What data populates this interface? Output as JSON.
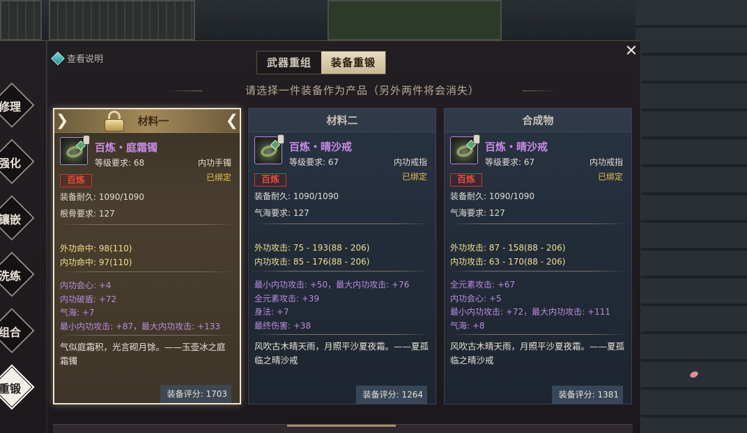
{
  "header": {
    "help_label": "查看说明",
    "tabs": [
      {
        "label": "武器重组",
        "active": false
      },
      {
        "label": "装备重锻",
        "active": true
      }
    ],
    "prompt": "请选择一件装备作为产品（另外两件将会消失）"
  },
  "side_menu": [
    {
      "label": "修理",
      "active": false
    },
    {
      "label": "强化",
      "active": false
    },
    {
      "label": "镶嵌",
      "active": false
    },
    {
      "label": "洗练",
      "active": false
    },
    {
      "label": "组合",
      "active": false
    },
    {
      "label": "重锻",
      "active": true
    }
  ],
  "cards": [
    {
      "header": "材料一",
      "selected": true,
      "item_name": "百炼・庭霜镯",
      "level_req": "等级要求: 68",
      "slot": "内功手镯",
      "badge": "百炼",
      "bound": "已绑定",
      "durability": "装备耐久: 1090/1090",
      "requirement": "根骨要求: 127",
      "main_stats": [
        "外功命中: 98(110)",
        "内功命中: 97(110)"
      ],
      "extra_stats": [
        "内功会心: +4",
        "内功破盾: +72",
        "气海: +7",
        "最小内功攻击: +87，最大内功攻击: +133"
      ],
      "lore": "气似庭霜积，光言砌月馀。——玉壶冰之庭霜镯",
      "score": "装备评分: 1703"
    },
    {
      "header": "材料二",
      "selected": false,
      "item_name": "百炼・晴沙戒",
      "level_req": "等级要求: 67",
      "slot": "内功戒指",
      "badge": "百炼",
      "bound": "已绑定",
      "durability": "装备耐久: 1090/1090",
      "requirement": "气海要求: 127",
      "main_stats": [
        "外功攻击: 75 - 193(88 - 206)",
        "内功攻击: 85 - 176(88 - 206)"
      ],
      "extra_stats": [
        "最小内功攻击: +50，最大内功攻击: +76",
        "全元素攻击: +39",
        "身法: +7",
        "最终伤害: +38"
      ],
      "lore": "风吹古木晴天雨，月照平沙夏夜霜。——夏孤临之晴沙戒",
      "score": "装备评分: 1264"
    },
    {
      "header": "合成物",
      "selected": false,
      "item_name": "百炼・晴沙戒",
      "level_req": "等级要求: 67",
      "slot": "内功戒指",
      "badge": "百炼",
      "bound": "已绑定",
      "durability": "装备耐久: 1090/1090",
      "requirement": "气海要求: 127",
      "main_stats": [
        "外功攻击: 87 - 158(88 - 206)",
        "内功攻击: 63 - 170(88 - 206)"
      ],
      "extra_stats": [
        "全元素攻击: +67",
        "内功会心: +5",
        "最小内功攻击: +72，最大内功攻击: +111",
        "气海: +8"
      ],
      "lore": "风吹古木晴天雨，月照平沙夏夜霜。——夏孤临之晴沙戒",
      "score": "装备评分: 1381"
    }
  ],
  "colors": {
    "item_name": "#c98ae8",
    "bound": "#e8c24a",
    "main_stat": "#efe08a",
    "extra_stat": "#b98ce0",
    "badge": "#e64a3a"
  },
  "icons": [
    "help-diamond-icon",
    "close-icon",
    "lock-icon",
    "bracelet-icon",
    "ring-icon",
    "arrow-left-icon",
    "arrow-right-icon"
  ]
}
